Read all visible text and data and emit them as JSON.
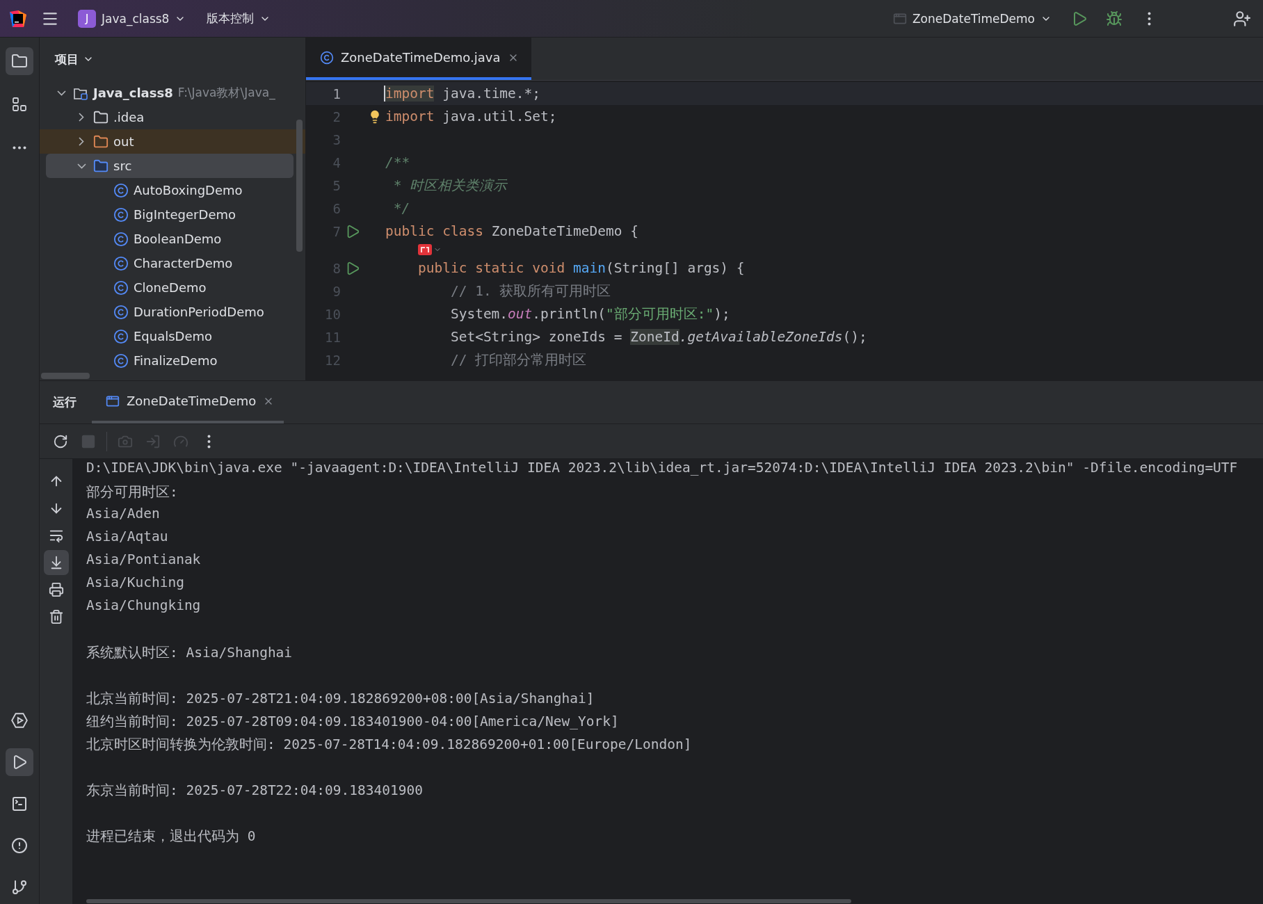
{
  "top_bar": {
    "project": {
      "badge": "J",
      "name": "Java_class8"
    },
    "vcs_menu": "版本控制",
    "run_config": "ZoneDateTimeDemo"
  },
  "tool_strip": {
    "top": [
      {
        "kind": "project",
        "selected": true
      },
      {
        "kind": "structure",
        "selected": false
      },
      {
        "kind": "more",
        "selected": false
      }
    ],
    "bottom": [
      {
        "kind": "services",
        "selected": false
      },
      {
        "kind": "run",
        "selected": true
      },
      {
        "kind": "terminal",
        "selected": false
      },
      {
        "kind": "problems",
        "selected": false
      },
      {
        "kind": "git",
        "selected": false
      }
    ]
  },
  "project_panel": {
    "title": "项目",
    "items": [
      {
        "label": "Java_class8",
        "path": "F:\\Java教材\\Java_",
        "kind": "module",
        "expanded": true,
        "selected": false,
        "children": [
          {
            "label": ".idea",
            "kind": "folder",
            "expanded": false,
            "selected": false
          },
          {
            "label": "out",
            "kind": "excluded_folder",
            "expanded": false,
            "selected": false
          },
          {
            "label": "src",
            "kind": "source_folder",
            "expanded": true,
            "selected": true,
            "children": [
              {
                "label": "AutoBoxingDemo",
                "kind": "class",
                "selected": false
              },
              {
                "label": "BigIntegerDemo",
                "kind": "class",
                "selected": false
              },
              {
                "label": "BooleanDemo",
                "kind": "class",
                "selected": false
              },
              {
                "label": "CharacterDemo",
                "kind": "class",
                "selected": false
              },
              {
                "label": "CloneDemo",
                "kind": "class",
                "selected": false
              },
              {
                "label": "DurationPeriodDemo",
                "kind": "class",
                "selected": false
              },
              {
                "label": "EqualsDemo",
                "kind": "class",
                "selected": false
              },
              {
                "label": "FinalizeDemo",
                "kind": "class",
                "selected": false
              }
            ]
          }
        ]
      }
    ]
  },
  "editor": {
    "tabs": [
      {
        "label": "ZoneDateTimeDemo.java",
        "selected": true
      }
    ],
    "lines": [
      {
        "number": "1",
        "current": true,
        "tokens": [
          {
            "t": "import",
            "kind": "kw_usage"
          },
          {
            "t": " java.time.*;",
            "kind": "plain"
          }
        ]
      },
      {
        "number": "2",
        "bulb": true,
        "tokens": [
          {
            "t": "import",
            "kind": "kw"
          },
          {
            "t": " java.util.Set;",
            "kind": "plain"
          }
        ]
      },
      {
        "number": "3"
      },
      {
        "number": "4",
        "tokens": [
          {
            "t": "/**",
            "kind": "doc"
          }
        ]
      },
      {
        "number": "5",
        "tokens": [
          {
            "t": " * 时区相关类演示",
            "kind": "doc"
          }
        ]
      },
      {
        "number": "6",
        "tokens": [
          {
            "t": " */",
            "kind": "doc"
          }
        ]
      },
      {
        "number": "7",
        "run": true,
        "hint": true,
        "tokens": [
          {
            "t": "public class ",
            "kind": "kw"
          },
          {
            "t": "ZoneDateTimeDemo {",
            "kind": "plain"
          }
        ]
      },
      {
        "number": "8",
        "run": true,
        "tokens": [
          {
            "t": "    public static void ",
            "kind": "kw"
          },
          {
            "t": "main",
            "kind": "decl"
          },
          {
            "t": "(String[] args) {",
            "kind": "plain"
          }
        ]
      },
      {
        "number": "9",
        "tokens": [
          {
            "t": "        // 1. 获取所有可用时区",
            "kind": "comment"
          }
        ]
      },
      {
        "number": "10",
        "tokens": [
          {
            "t": "        System.",
            "kind": "plain"
          },
          {
            "t": "out",
            "kind": "field"
          },
          {
            "t": ".println(",
            "kind": "plain"
          },
          {
            "t": "\"部分可用时区:\"",
            "kind": "str"
          },
          {
            "t": ");",
            "kind": "plain"
          }
        ]
      },
      {
        "number": "11",
        "tokens": [
          {
            "t": "        Set<String> zoneIds = ",
            "kind": "plain"
          },
          {
            "t": "ZoneId",
            "kind": "usage"
          },
          {
            "t": ".getAvailableZoneIds",
            "kind": "call"
          },
          {
            "t": "();",
            "kind": "plain"
          }
        ]
      },
      {
        "number": "12",
        "tokens": [
          {
            "t": "        // 打印部分常用时区",
            "kind": "comment"
          }
        ]
      }
    ]
  },
  "run_panel": {
    "title": "运行",
    "tabs": [
      {
        "label": "ZoneDateTimeDemo",
        "selected": true
      }
    ],
    "toolbar": [
      {
        "kind": "rerun",
        "disabled": false
      },
      {
        "kind": "stop",
        "disabled": true
      },
      {
        "kind": "divider"
      },
      {
        "kind": "camera",
        "disabled": true
      },
      {
        "kind": "exit",
        "disabled": true
      },
      {
        "kind": "gauge",
        "disabled": true
      },
      {
        "kind": "more",
        "disabled": false
      }
    ],
    "side_tools": [
      {
        "kind": "up",
        "selected": false
      },
      {
        "kind": "down",
        "selected": false
      },
      {
        "kind": "wrap",
        "selected": false
      },
      {
        "kind": "scroll_end",
        "selected": true
      },
      {
        "kind": "print",
        "selected": false
      },
      {
        "kind": "clear",
        "selected": false
      }
    ],
    "console_blocks": [
      [
        "D:\\IDEA\\JDK\\bin\\java.exe \"-javaagent:D:\\IDEA\\IntelliJ IDEA 2023.2\\lib\\idea_rt.jar=52074:D:\\IDEA\\IntelliJ IDEA 2023.2\\bin\" -Dfile.encoding=UTF",
        "部分可用时区:",
        "Asia/Aden",
        "Asia/Aqtau",
        "Asia/Pontianak",
        "Asia/Kuching",
        "Asia/Chungking"
      ],
      [
        "系统默认时区: Asia/Shanghai"
      ],
      [
        "北京当前时间: 2025-07-28T21:04:09.182869200+08:00[Asia/Shanghai]",
        "纽约当前时间: 2025-07-28T09:04:09.183401900-04:00[America/New_York]",
        "北京时区时间转换为伦敦时间: 2025-07-28T14:04:09.182869200+01:00[Europe/London]"
      ],
      [
        "东京当前时间: 2025-07-28T22:04:09.183401900"
      ],
      [
        "进程已结束，退出代码为 0"
      ]
    ]
  }
}
